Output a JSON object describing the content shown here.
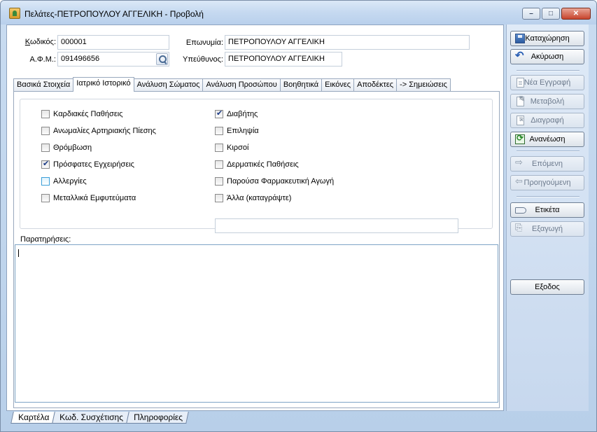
{
  "window": {
    "title": "Πελάτες-ΠΕΤΡΟΠΟΥΛΟΥ ΑΓΓΕΛΙΚΗ -  Προβολή"
  },
  "header": {
    "code_label_underlined": "Κ",
    "code_label_rest": "ωδικός:",
    "code_value": "000001",
    "afm_label": "Α.Φ.Μ.:",
    "afm_value": "091496656",
    "name_label": "Επωνυμία:",
    "name_value": "ΠΕΤΡΟΠΟΥΛΟΥ ΑΓΓΕΛΙΚΗ",
    "responsible_label": "Υπεύθυνος:",
    "responsible_value": "ΠΕΤΡΟΠΟΥΛΟΥ ΑΓΓΕΛΙΚΗ"
  },
  "tabs": [
    {
      "label": "Βασικά Στοιχεία",
      "active": false
    },
    {
      "label": "Ιατρικό Ιστορικό",
      "active": true
    },
    {
      "label": "Ανάλυση Σώματος",
      "active": false
    },
    {
      "label": "Ανάλυση Προσώπου",
      "active": false
    },
    {
      "label": "Βοηθητικά",
      "active": false
    },
    {
      "label": "Εικόνες",
      "active": false
    },
    {
      "label": "Αποδέκτες",
      "active": false
    },
    {
      "label": "-> Σημειώσεις",
      "active": false
    }
  ],
  "medical": {
    "left": [
      {
        "label": "Καρδιακές Παθήσεις",
        "checked": false
      },
      {
        "label": "Ανωμαλίες Αρτηριακής Πίεσης",
        "checked": false
      },
      {
        "label": "Θρόμβωση",
        "checked": false
      },
      {
        "label": "Πρόσφατες Εγχειρήσεις",
        "checked": true
      },
      {
        "label": "Αλλεργίες",
        "checked": false
      },
      {
        "label": "Μεταλλικά Εμφυτεύματα",
        "checked": false
      }
    ],
    "right": [
      {
        "label": "Διαβήτης",
        "checked": true
      },
      {
        "label": "Επιληψία",
        "checked": false
      },
      {
        "label": "Κιρσοί",
        "checked": false
      },
      {
        "label": "Δερματικές Παθήσεις",
        "checked": false
      },
      {
        "label": "Παρούσα Φαρμακευτική Αγωγή",
        "checked": false
      },
      {
        "label": "Άλλα (καταγράψτε)",
        "checked": false
      }
    ],
    "other_value": "",
    "notes_label": "Παρατηρήσεις:",
    "notes_value": ""
  },
  "bottom_tabs": [
    "Καρτέλα",
    "Κωδ. Συσχέτισης",
    "Πληροφορίες"
  ],
  "actions": {
    "save": "Καταχώρηση",
    "cancel": "Ακύρωση",
    "new": "Νέα Εγγραφή",
    "edit": "Μεταβολή",
    "delete": "Διαγραφή",
    "refresh": "Ανανέωση",
    "next": "Επόμενη",
    "prev": "Προηγούμενη",
    "label": "Ετικέτα",
    "export": "Εξαγωγή",
    "exit": "Εξοδος"
  }
}
